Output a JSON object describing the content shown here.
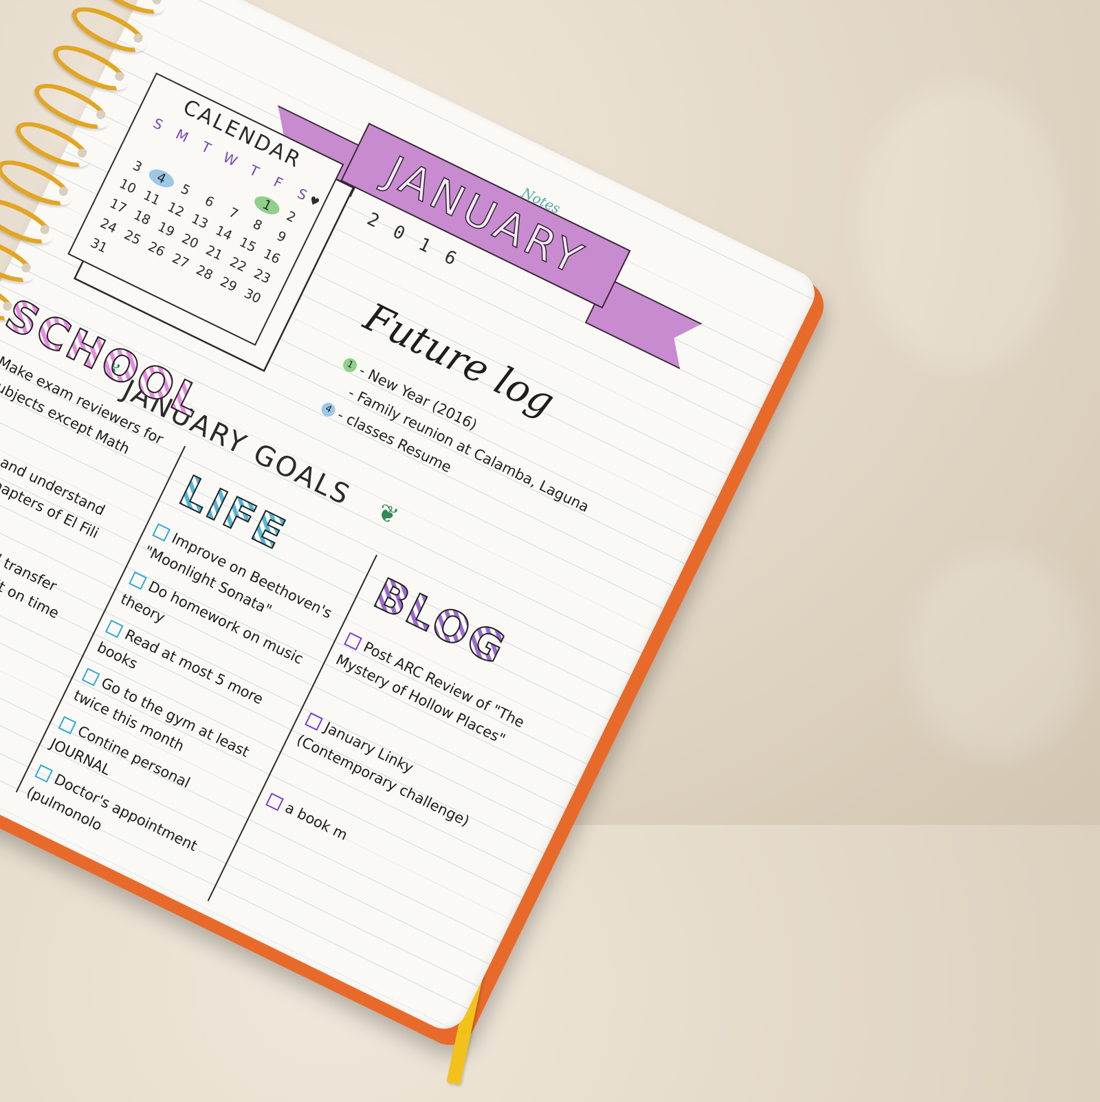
{
  "colors": {
    "banner": "#c98bd0",
    "school_accent": "#e34bd1",
    "life_accent": "#31a8d6",
    "blog_accent": "#7d3fd1",
    "spiral": "#e2a524",
    "cover": "#e86a2b",
    "ribbon": "#f2c21a",
    "highlight_blue": "#9cc8e6",
    "highlight_green": "#8fd08a"
  },
  "page_header": {
    "notes_label": "Notes"
  },
  "banner": {
    "title": "JANUARY",
    "year": "2016"
  },
  "calendar": {
    "title": "CALENDAR",
    "weekdays": [
      "S",
      "M",
      "T",
      "W",
      "T",
      "F",
      "S"
    ],
    "heart_icon": "heart-icon",
    "rows": [
      [
        "",
        "",
        "",
        "",
        "",
        "1",
        "2"
      ],
      [
        "3",
        "4",
        "5",
        "6",
        "7",
        "8",
        "9"
      ],
      [
        "10",
        "11",
        "12",
        "13",
        "14",
        "15",
        "16"
      ],
      [
        "17",
        "18",
        "19",
        "20",
        "21",
        "22",
        "23"
      ],
      [
        "24",
        "25",
        "26",
        "27",
        "28",
        "29",
        "30"
      ],
      [
        "31",
        "",
        "",
        "",
        "",
        "",
        ""
      ]
    ],
    "highlight_blue": "4",
    "highlight_green": "1"
  },
  "future_log": {
    "title": "Future log",
    "items": [
      {
        "marker": "1",
        "marker_color": "green",
        "text": "- New Year (2016)"
      },
      {
        "marker": "",
        "marker_color": "none",
        "text": "- Family reunion at Calamba, Laguna"
      },
      {
        "marker": "4",
        "marker_color": "blue",
        "text": "- classes Resume"
      }
    ]
  },
  "goals": {
    "title": "JANUARY GOALS",
    "school": {
      "heading": "SCHOOL",
      "tasks": [
        {
          "text": "Make exam reviewers for all subjects except Math",
          "done": false
        },
        {
          "text": "Study and understand last few chapters of El Fili",
          "done": false
        },
        {
          "text": "complete all transfer tasks and submit on time",
          "done": true
        }
      ]
    },
    "life": {
      "heading": "LIFE",
      "tasks": [
        {
          "text": "Improve on Beethoven's \"Moonlight Sonata\"",
          "done": false
        },
        {
          "text": "Do homework on music theory",
          "done": false
        },
        {
          "text": "Read at most 5 more books",
          "done": false
        },
        {
          "text": "Go to the gym at least twice this month",
          "done": false
        },
        {
          "text": "Contine personal JOURNAL",
          "done": false
        },
        {
          "text": "Doctor's appointment (pulmonolo",
          "done": false
        }
      ]
    },
    "blog": {
      "heading": "BLOG",
      "tasks": [
        {
          "text": "Post ARC Review of \"The Mystery of Hollow Places\"",
          "done": false
        },
        {
          "text": "January Linky (Contemporary challenge)",
          "done": false
        },
        {
          "text": "a book m",
          "done": false
        }
      ]
    }
  }
}
